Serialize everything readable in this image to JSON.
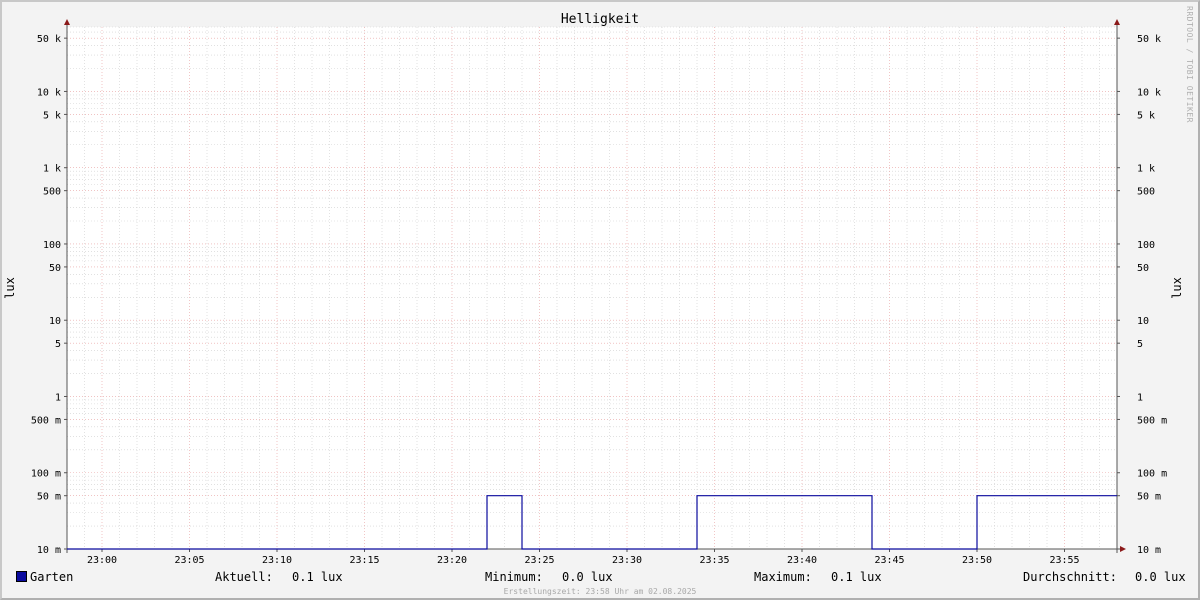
{
  "chart_data": {
    "type": "line",
    "title": "Helligkeit",
    "ylabel": "lux",
    "ylabel_right": "lux",
    "yscale": "log",
    "ylim": [
      0.01,
      70000
    ],
    "y_ticks": [
      {
        "value": 50000,
        "label": "50 k"
      },
      {
        "value": 10000,
        "label": "10 k"
      },
      {
        "value": 5000,
        "label": "5 k"
      },
      {
        "value": 1000,
        "label": "1 k"
      },
      {
        "value": 500,
        "label": "500"
      },
      {
        "value": 100,
        "label": "100"
      },
      {
        "value": 50,
        "label": "50"
      },
      {
        "value": 10,
        "label": "10"
      },
      {
        "value": 5,
        "label": "5"
      },
      {
        "value": 1,
        "label": "1"
      },
      {
        "value": 0.5,
        "label": "500 m"
      },
      {
        "value": 0.1,
        "label": "100 m"
      },
      {
        "value": 0.05,
        "label": "50 m"
      },
      {
        "value": 0.01,
        "label": "10 m"
      }
    ],
    "xlim": [
      "22:58",
      "23:58"
    ],
    "x_ticks": [
      "23:00",
      "23:05",
      "23:10",
      "23:15",
      "23:20",
      "23:25",
      "23:30",
      "23:35",
      "23:40",
      "23:45",
      "23:50",
      "23:55"
    ],
    "grid": true,
    "series": [
      {
        "name": "Garten",
        "color": "#0a0a9e",
        "points": [
          [
            "22:58",
            0.01
          ],
          [
            "23:22",
            0.01
          ],
          [
            "23:22",
            0.05
          ],
          [
            "23:24",
            0.05
          ],
          [
            "23:24",
            0.01
          ],
          [
            "23:34",
            0.01
          ],
          [
            "23:34",
            0.05
          ],
          [
            "23:44",
            0.05
          ],
          [
            "23:44",
            0.01
          ],
          [
            "23:50",
            0.01
          ],
          [
            "23:50",
            0.05
          ],
          [
            "23:58",
            0.05
          ]
        ]
      }
    ]
  },
  "legend": {
    "series_name": "Garten",
    "current_label": "Aktuell:",
    "current_value": "0.1 lux",
    "min_label": "Minimum:",
    "min_value": "0.0 lux",
    "max_label": "Maximum:",
    "max_value": "0.1 lux",
    "avg_label": "Durchschnitt:",
    "avg_value": "0.0 lux"
  },
  "footer_text": "Erstellungszeit: 23:58 Uhr am 02.08.2025",
  "watermark_text": "RRDTOOL / TOBI OETIKER"
}
